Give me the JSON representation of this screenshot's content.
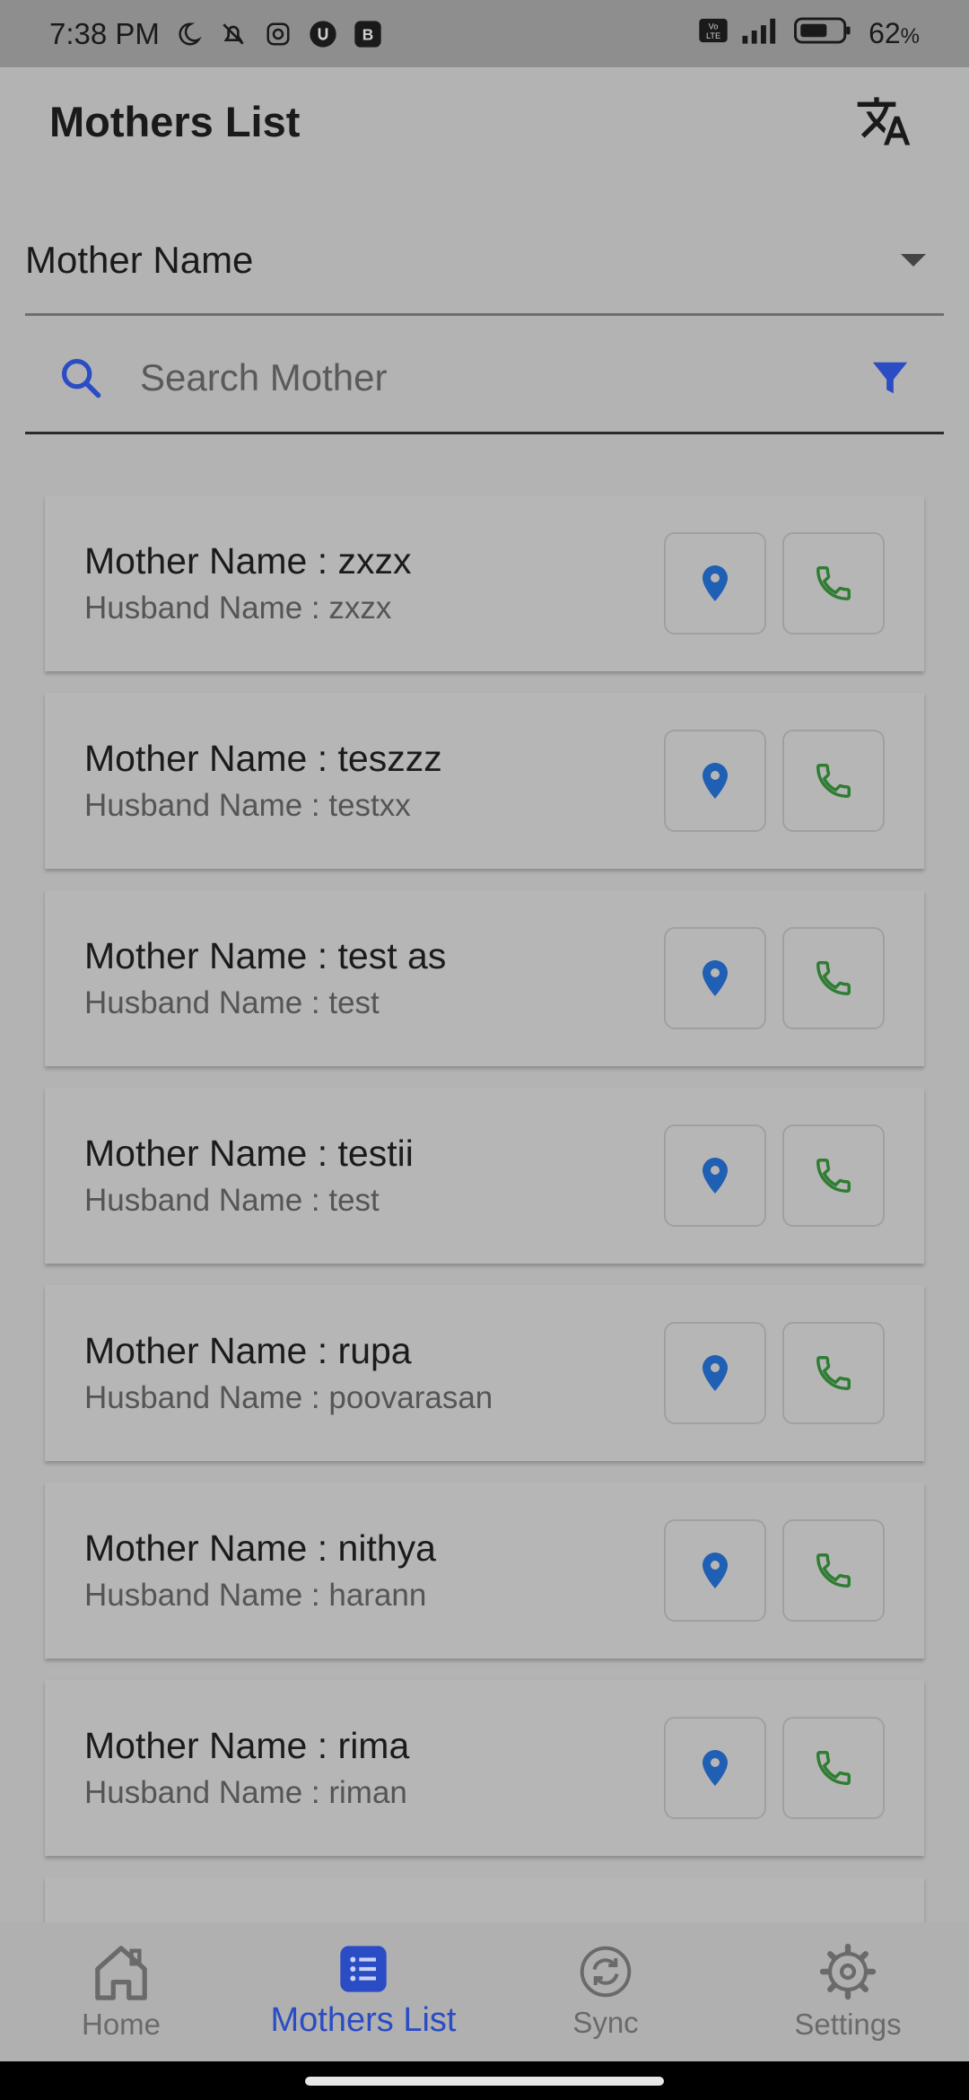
{
  "status_bar": {
    "time": "7:38 PM",
    "battery": "62",
    "battery_unit": "%"
  },
  "app_bar": {
    "title": "Mothers List"
  },
  "filter": {
    "selected": "Mother Name"
  },
  "search": {
    "placeholder": "Search Mother"
  },
  "mothers": [
    {
      "mother": "Mother Name : zxzx",
      "husband": "Husband Name : zxzx"
    },
    {
      "mother": "Mother Name : teszzz",
      "husband": "Husband Name : testxx"
    },
    {
      "mother": "Mother Name : test as",
      "husband": "Husband Name : test"
    },
    {
      "mother": "Mother Name : testii",
      "husband": "Husband Name : test"
    },
    {
      "mother": "Mother Name : rupa",
      "husband": "Husband Name : poovarasan"
    },
    {
      "mother": "Mother Name : nithya",
      "husband": "Husband Name : harann"
    },
    {
      "mother": "Mother Name : rima",
      "husband": "Husband Name : riman"
    }
  ],
  "nav": {
    "home": "Home",
    "mothers_list": "Mothers List",
    "sync": "Sync",
    "settings": "Settings"
  },
  "colors": {
    "accent": "#2a4cc4",
    "location": "#1f5fb4",
    "phone": "#2e7d32"
  }
}
